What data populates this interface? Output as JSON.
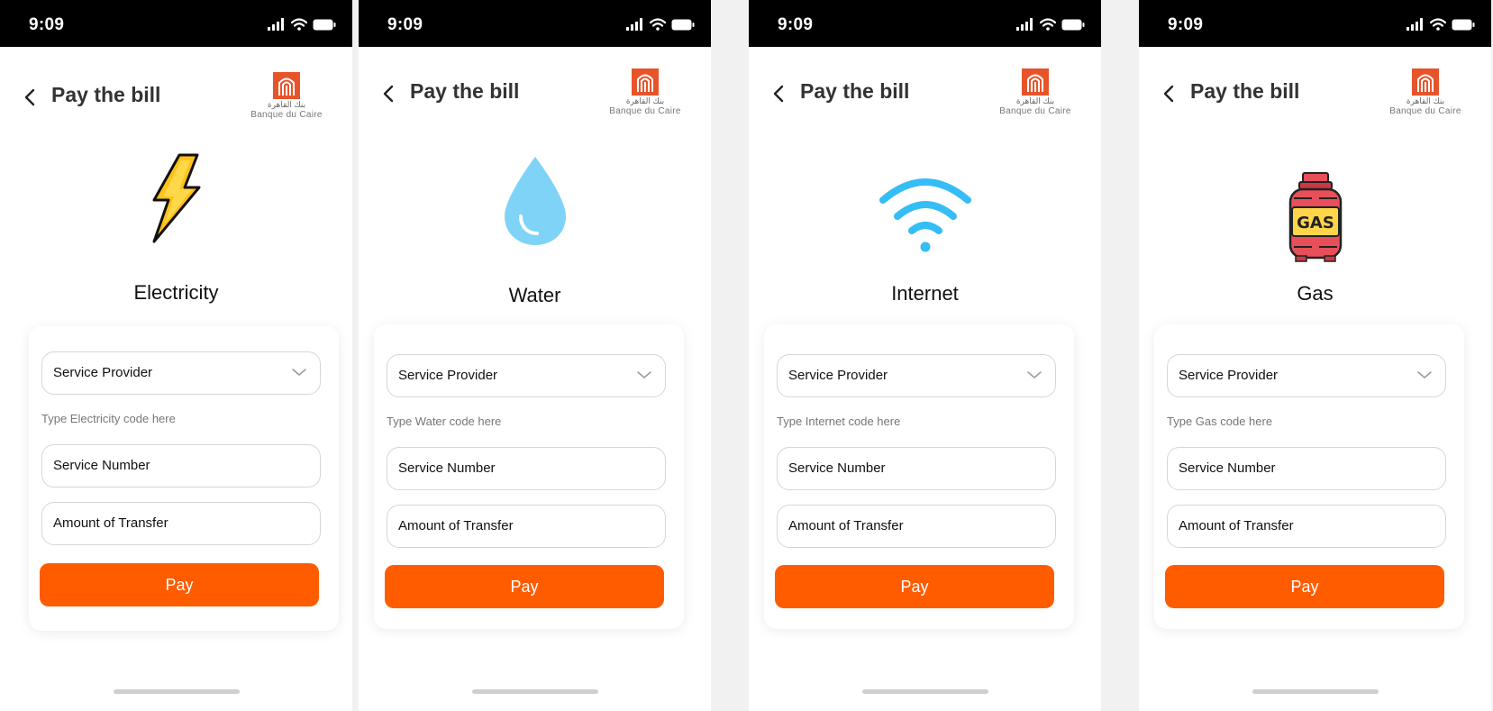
{
  "status": {
    "time": "9:09"
  },
  "header": {
    "title": "Pay the bill"
  },
  "logo": {
    "arabic": "بنك القاهرة",
    "latin": "Banque du Caire"
  },
  "screens": [
    {
      "service": "Electricity",
      "icon": "lightning-icon",
      "provider_placeholder": "Service Provider",
      "hint": "Type Electricity code here",
      "service_number_placeholder": "Service Number",
      "amount_placeholder": "Amount of Transfer",
      "pay_label": "Pay"
    },
    {
      "service": "Water",
      "icon": "water-drop-icon",
      "provider_placeholder": "Service Provider",
      "hint": "Type Water code here",
      "service_number_placeholder": "Service Number",
      "amount_placeholder": "Amount of Transfer",
      "pay_label": "Pay"
    },
    {
      "service": "Internet",
      "icon": "wifi-signal-icon",
      "provider_placeholder": "Service Provider",
      "hint": "Type Internet code here",
      "service_number_placeholder": "Service Number",
      "amount_placeholder": "Amount of Transfer",
      "pay_label": "Pay"
    },
    {
      "service": "Gas",
      "icon": "gas-cylinder-icon",
      "icon_text": "GAS",
      "provider_placeholder": "Service Provider",
      "hint": "Type Gas code here",
      "service_number_placeholder": "Service Number",
      "amount_placeholder": "Amount of Transfer",
      "pay_label": "Pay"
    }
  ],
  "colors": {
    "accent": "#ff5c00",
    "status_bar": "#000000",
    "background": "#f1f1f1",
    "lightning": "#ffc21a",
    "water": "#7fd3f7",
    "wifi": "#35bdf5",
    "gas": "#e7505a"
  }
}
